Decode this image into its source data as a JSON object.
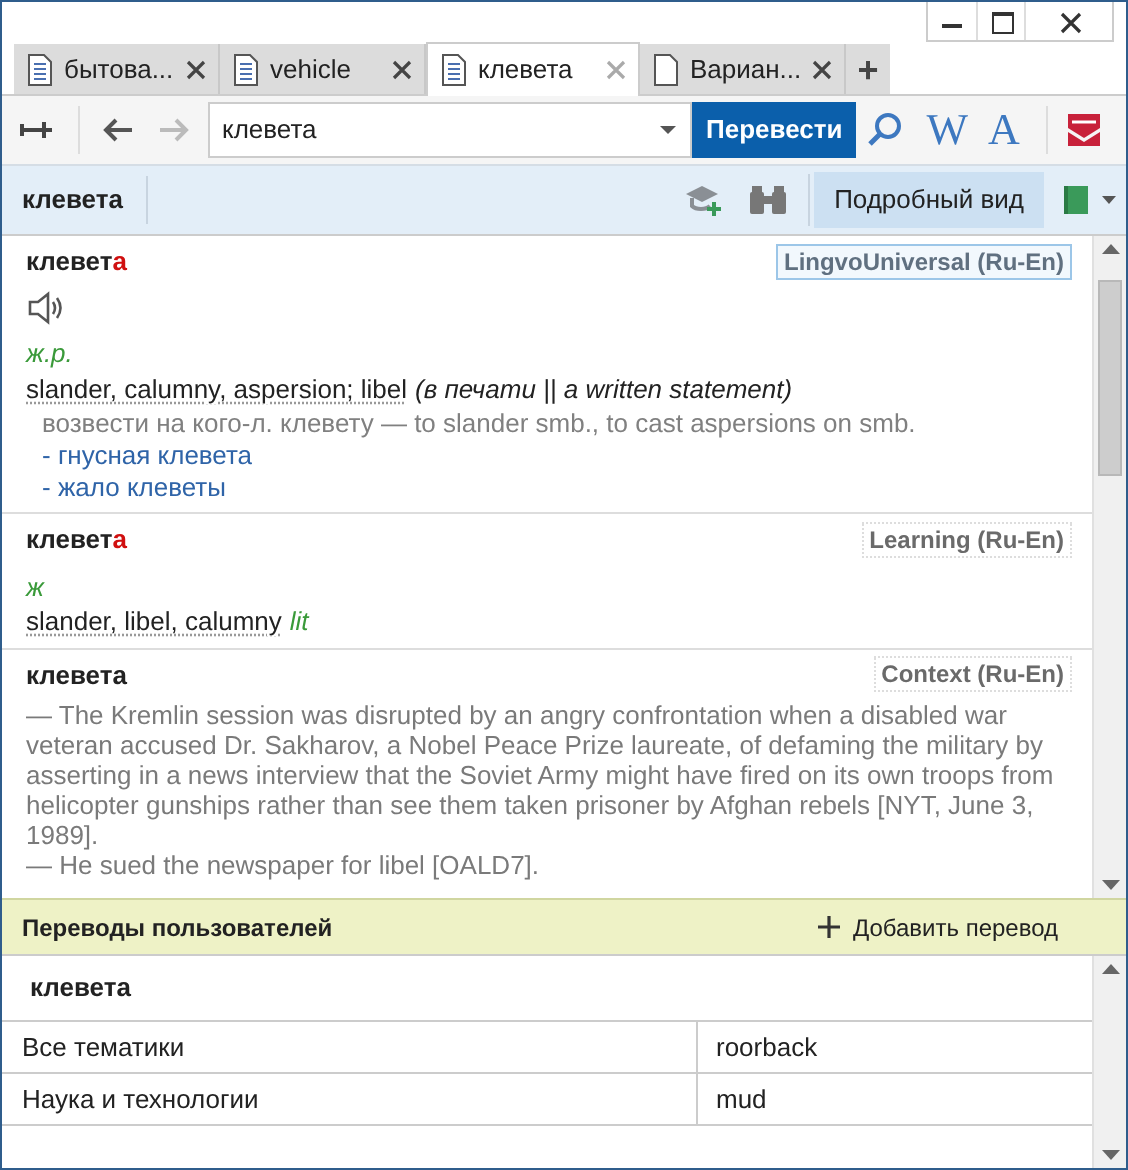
{
  "tabs": [
    {
      "label": "бытова...",
      "selected": false,
      "kind": "article"
    },
    {
      "label": "vehicle",
      "selected": false,
      "kind": "article"
    },
    {
      "label": "клевета",
      "selected": true,
      "kind": "article"
    },
    {
      "label": "Вариан...",
      "selected": false,
      "kind": "variants"
    }
  ],
  "new_tab": "+",
  "toolbar": {
    "search_value": "клевета",
    "forward_disabled": true,
    "translate_button": "Перевести",
    "letter_tools": [
      "W",
      "A"
    ]
  },
  "headword_bar": {
    "word": "клевета",
    "view_button": {
      "label": "Подробный вид",
      "selected": true
    }
  },
  "articles": [
    {
      "kind": "universal",
      "headword": "клевет",
      "stressed_letter": "а",
      "dictionary": "LingvoUniversal (Ru-En)",
      "highlighted": true,
      "pos": "ж.р.",
      "translation": "slander, calumny, aspersion; libel",
      "note": "(в печати || a written statement)",
      "example": "возвести на кого-л. клевету — to slander smb., to cast aspersions on smb.",
      "links": [
        "- гнусная клевета",
        "- жало клеветы"
      ]
    },
    {
      "kind": "learning",
      "headword": "клевет",
      "stressed_letter": "а",
      "dictionary": "Learning (Ru-En)",
      "highlighted": false,
      "pos": "ж",
      "translation": "slander, libel, calumny",
      "label": "lit"
    },
    {
      "kind": "context",
      "headword": "клевета",
      "dictionary": "Context (Ru-En)",
      "highlighted": false,
      "paragraphs": [
        "— The Kremlin session was disrupted by an angry confrontation when a disabled war veteran accused Dr. Sakharov, a Nobel Peace Prize laureate, of defaming the military by asserting in a news interview that the Soviet Army might have fired on its own troops from helicopter gunships rather than see them taken prisoner by Afghan rebels [NYT, June 3, 1989].",
        "— He sued the newspaper for libel [OALD7]."
      ]
    }
  ],
  "user_translations": {
    "title": "Переводы пользователей",
    "add_button": "Добавить перевод",
    "word": "клевета",
    "rows": [
      {
        "topic": "Все тематики",
        "translation": "roorback"
      },
      {
        "topic": "Наука и технологии",
        "translation": "mud"
      }
    ]
  }
}
